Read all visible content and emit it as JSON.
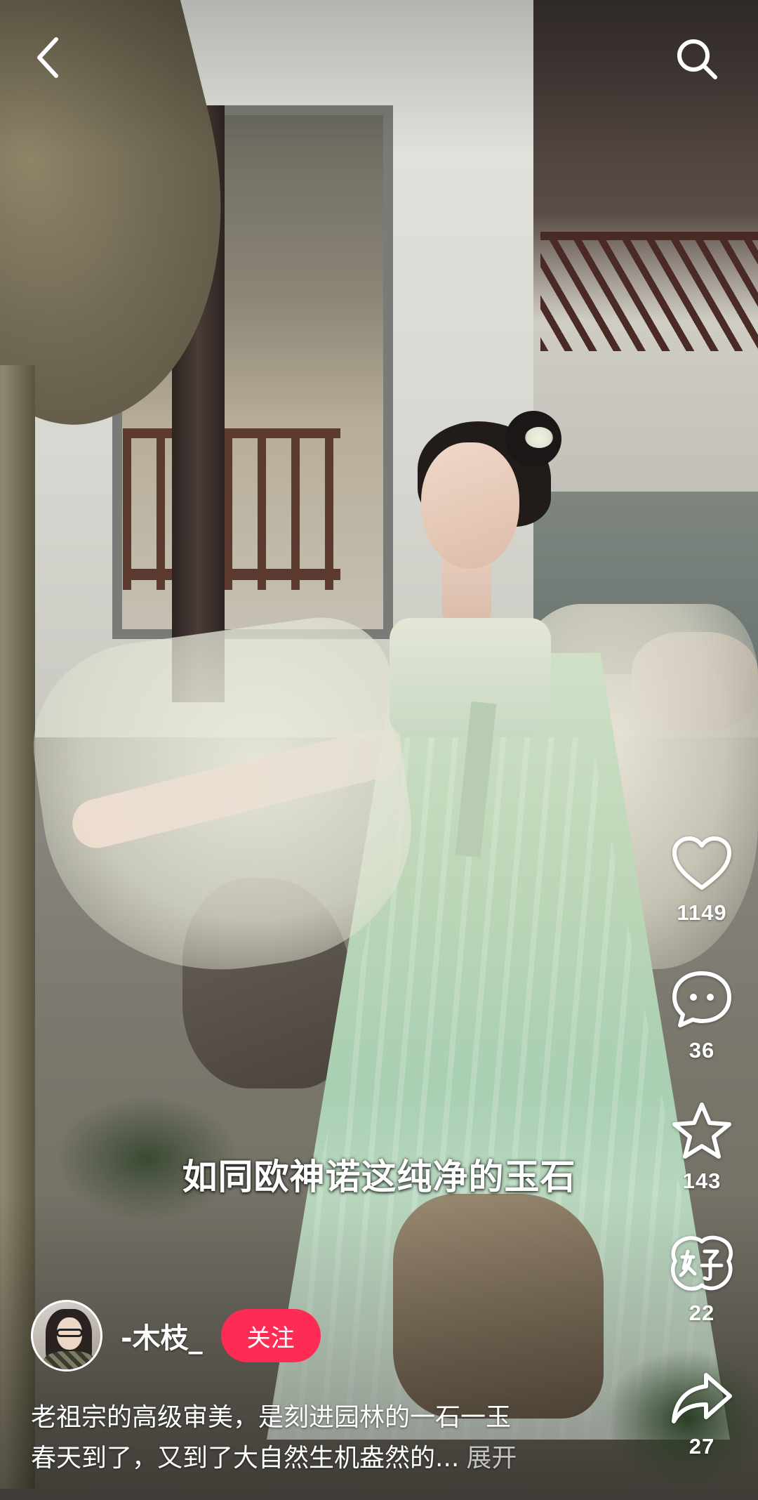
{
  "top_bar": {
    "back_icon": "chevron-left-icon",
    "search_icon": "search-icon"
  },
  "video": {
    "subtitle": "如同欧神诺这纯净的玉石"
  },
  "actions": {
    "like": {
      "icon": "heart-icon",
      "count": "1149"
    },
    "comment": {
      "icon": "comment-bubble-icon",
      "count": "36"
    },
    "favorite": {
      "icon": "star-icon",
      "count": "143"
    },
    "rate": {
      "icon": "hao-badge-icon",
      "count": "22"
    },
    "share": {
      "icon": "share-arrow-icon",
      "count": "27"
    }
  },
  "author": {
    "name": "-木枝_",
    "follow_label": "关注"
  },
  "description": {
    "line1": "老祖宗的高级审美，是刻进园林的一石一玉",
    "line2": "春天到了，又到了大自然生机盎然的...",
    "expand_label": "展开"
  },
  "colors": {
    "follow_button": "#fe2c55",
    "text": "#ffffff"
  }
}
